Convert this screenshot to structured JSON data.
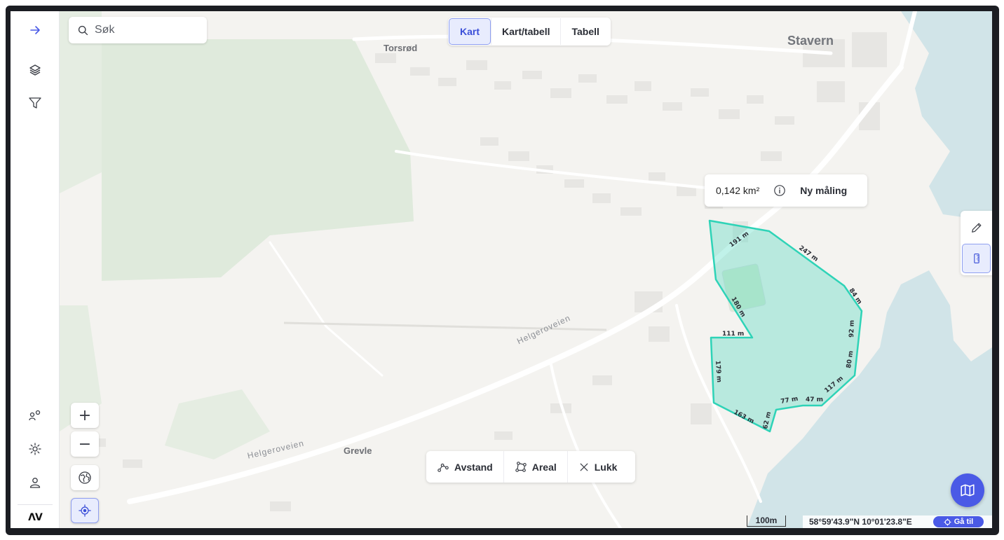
{
  "sidebar": {
    "items": [
      {
        "name": "expand-sidebar",
        "icon": "arrow-right-icon"
      },
      {
        "name": "layers",
        "icon": "layers-icon"
      },
      {
        "name": "filter",
        "icon": "filter-icon"
      },
      {
        "name": "share-users",
        "icon": "users-icon"
      },
      {
        "name": "settings",
        "icon": "gear-icon"
      },
      {
        "name": "profile",
        "icon": "user-icon"
      }
    ],
    "logo_text": "ΛV"
  },
  "search": {
    "placeholder": "Søk"
  },
  "view_toggle": {
    "options": [
      "Kart",
      "Kart/tabell",
      "Tabell"
    ],
    "selected": "Kart"
  },
  "map": {
    "places": [
      {
        "name": "Stavern"
      },
      {
        "name": "Torsrød"
      },
      {
        "name": "Grevle"
      }
    ],
    "roads": [
      "Helgeroveien",
      "Helgeroveien"
    ],
    "polygon_segments": [
      "191 m",
      "247 m",
      "84 m",
      "92 m",
      "80 m",
      "117 m",
      "47 m",
      "77 m",
      "62 m",
      "163 m",
      "179 m",
      "111 m",
      "180 m"
    ],
    "polygon_color": "#2ed3b7"
  },
  "measurement": {
    "area": "0,142 km²",
    "info_icon": "info-icon",
    "new_label": "Ny måling"
  },
  "draw_tools": [
    {
      "name": "pencil",
      "icon": "pencil-icon"
    },
    {
      "name": "ruler",
      "icon": "ruler-icon",
      "active": true
    }
  ],
  "zoom": {
    "in": "+",
    "out": "−"
  },
  "bottom_toolbar": {
    "distance_label": "Avstand",
    "area_label": "Areal",
    "close_label": "Lukk"
  },
  "scale_label": "100m",
  "coordinates": "58°59'43.9\"N 10°01'23.8\"E",
  "goto_label": "Gå til",
  "colors": {
    "accent": "#4a5ae6",
    "water": "#d1e4e8",
    "forest": "#dfeadc"
  }
}
